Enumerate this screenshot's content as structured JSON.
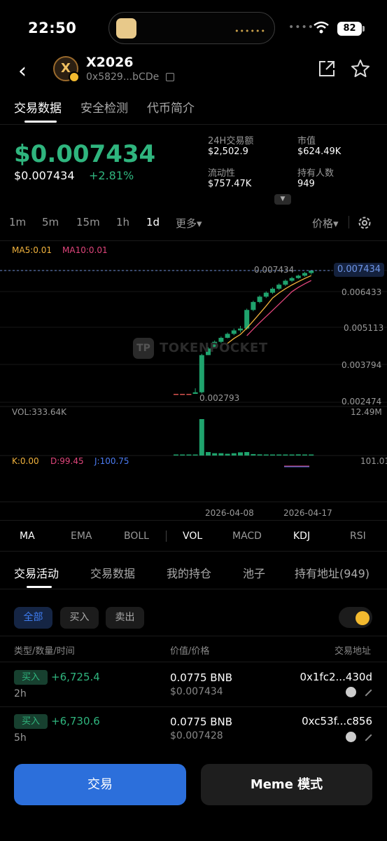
{
  "status": {
    "time": "22:50",
    "battery": "82"
  },
  "header": {
    "name": "X2026",
    "address": "0x5829...bCDe",
    "logo_letter": "X"
  },
  "top_tabs": [
    "交易数据",
    "安全检测",
    "代币简介"
  ],
  "price": {
    "main": "$0.007434",
    "usd": "$0.007434",
    "change": "+2.81%"
  },
  "stats": [
    {
      "label": "24H交易额",
      "value": "$2,502.9"
    },
    {
      "label": "市值",
      "value": "$624.49K"
    },
    {
      "label": "流动性",
      "value": "$757.47K"
    },
    {
      "label": "持有人数",
      "value": "949"
    }
  ],
  "timeframes": [
    "1m",
    "5m",
    "15m",
    "1h",
    "1d",
    "更多▾"
  ],
  "active_timeframe": "1d",
  "price_type": "价格▾",
  "chart_data": {
    "type": "candlestick",
    "ma_labels": {
      "ma5": "MA5:0.01",
      "ma10": "MA10:0.01"
    },
    "y_ticks": [
      "0.006433",
      "0.005113",
      "0.003794",
      "0.002474"
    ],
    "current_price_tag": "0.007434",
    "high_label": "0.007434",
    "low_label": "0.002793",
    "vol_label": "VOL:333.64K",
    "vol_max": "12.49M",
    "kdj": {
      "k": "K:0.00",
      "d": "D:99.45",
      "j": "J:100.75"
    },
    "kdj_max": "101.01",
    "x_labels": [
      "2026-04-08",
      "2026-04-17"
    ],
    "candles": [
      {
        "o": 0.00279,
        "h": 0.00279,
        "l": 0.00279,
        "c": 0.00279,
        "v": 0.05
      },
      {
        "o": 0.00279,
        "h": 0.00279,
        "l": 0.00279,
        "c": 0.00279,
        "v": 0.05
      },
      {
        "o": 0.00279,
        "h": 0.00279,
        "l": 0.00279,
        "c": 0.00279,
        "v": 0.05
      },
      {
        "o": 0.00279,
        "h": 0.003,
        "l": 0.00279,
        "c": 0.00285,
        "v": 0.1
      },
      {
        "o": 0.00285,
        "h": 0.0043,
        "l": 0.0028,
        "c": 0.00425,
        "v": 12.49
      },
      {
        "o": 0.00425,
        "h": 0.00455,
        "l": 0.00425,
        "c": 0.0045,
        "v": 1.2
      },
      {
        "o": 0.0045,
        "h": 0.0048,
        "l": 0.0045,
        "c": 0.00475,
        "v": 0.8
      },
      {
        "o": 0.00475,
        "h": 0.00495,
        "l": 0.0047,
        "c": 0.0049,
        "v": 0.8
      },
      {
        "o": 0.0049,
        "h": 0.0051,
        "l": 0.00488,
        "c": 0.00505,
        "v": 0.6
      },
      {
        "o": 0.00505,
        "h": 0.00525,
        "l": 0.005,
        "c": 0.00518,
        "v": 0.8
      },
      {
        "o": 0.00518,
        "h": 0.00535,
        "l": 0.0051,
        "c": 0.00525,
        "v": 1.1
      },
      {
        "o": 0.00525,
        "h": 0.006,
        "l": 0.0052,
        "c": 0.00595,
        "v": 1.2
      },
      {
        "o": 0.00595,
        "h": 0.0063,
        "l": 0.0059,
        "c": 0.00625,
        "v": 0.5
      },
      {
        "o": 0.00625,
        "h": 0.0065,
        "l": 0.0062,
        "c": 0.00645,
        "v": 0.4
      },
      {
        "o": 0.00645,
        "h": 0.00665,
        "l": 0.0064,
        "c": 0.0066,
        "v": 0.3
      },
      {
        "o": 0.0066,
        "h": 0.0068,
        "l": 0.00655,
        "c": 0.00675,
        "v": 0.3
      },
      {
        "o": 0.00675,
        "h": 0.00695,
        "l": 0.0067,
        "c": 0.0069,
        "v": 0.3
      },
      {
        "o": 0.0069,
        "h": 0.0071,
        "l": 0.00685,
        "c": 0.00705,
        "v": 0.3
      },
      {
        "o": 0.00705,
        "h": 0.0072,
        "l": 0.007,
        "c": 0.00715,
        "v": 0.3
      },
      {
        "o": 0.00715,
        "h": 0.00728,
        "l": 0.00712,
        "c": 0.00724,
        "v": 0.4
      },
      {
        "o": 0.00724,
        "h": 0.00738,
        "l": 0.0072,
        "c": 0.00734,
        "v": 0.3
      },
      {
        "o": 0.00734,
        "h": 0.00745,
        "l": 0.00728,
        "c": 0.007434,
        "v": 0.3
      }
    ],
    "ylim": [
      0.002474,
      0.007434
    ],
    "colors": {
      "up": "#1fa36d",
      "ma5": "#f2b33d",
      "ma10": "#e0457b",
      "k": "#f2b33d",
      "d": "#e0457b",
      "j": "#4b7bf2",
      "price_line": "#6f8fd8"
    }
  },
  "watermark": "TOKENPOCKET",
  "indicators": [
    "MA",
    "EMA",
    "BOLL",
    "VOL",
    "MACD",
    "KDJ",
    "RSI"
  ],
  "activity_tabs": [
    "交易活动",
    "交易数据",
    "我的持仓",
    "池子",
    "持有地址(949)"
  ],
  "filters": [
    "全部",
    "买入",
    "卖出"
  ],
  "table_headers": [
    "类型/数量/时间",
    "价值/价格",
    "交易地址"
  ],
  "trades": [
    {
      "type": "买入",
      "amount": "+6,725.4",
      "time": "2h",
      "bnb": "0.0775 BNB",
      "price": "$0.007434",
      "addr": "0x1fc2...430d"
    },
    {
      "type": "买入",
      "amount": "+6,730.6",
      "time": "5h",
      "bnb": "0.0775 BNB",
      "price": "$0.007428",
      "addr": "0xc53f...c856"
    }
  ],
  "buttons": {
    "trade": "交易",
    "meme": "Meme 模式"
  }
}
